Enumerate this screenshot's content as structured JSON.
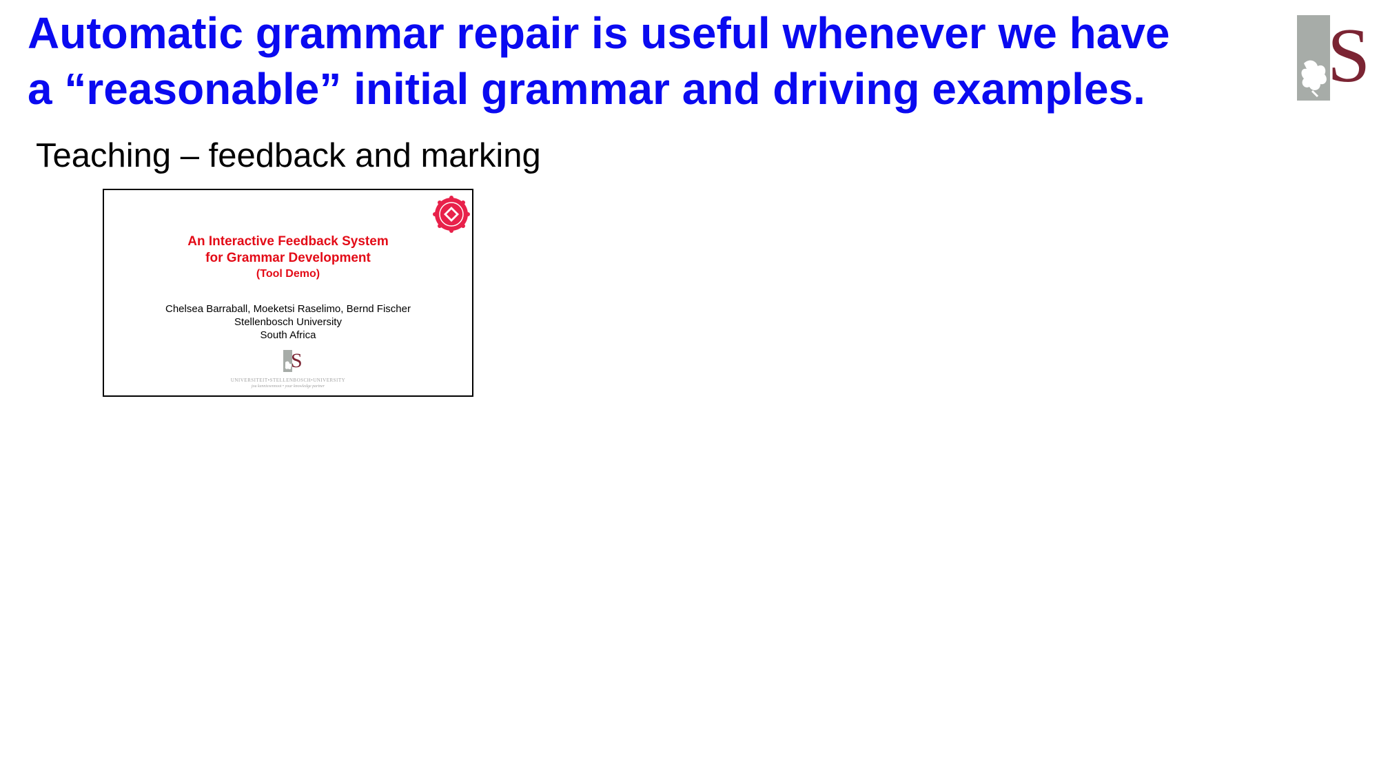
{
  "slide": {
    "title_lines": [
      "Automatic grammar repair is useful whenever we have",
      "a “reasonable” initial grammar and driving examples."
    ],
    "subtitle": "Teaching – feedback and marking"
  },
  "logo": {
    "letter": "S",
    "icon": "stellenbosch-university-logo-icon"
  },
  "thumbnail": {
    "title_line1": "An Interactive Feedback System",
    "title_line2": "for Grammar Development",
    "title_line3": "(Tool Demo)",
    "authors": "Chelsea Barraball, Moeketsi Raselimo, Bernd Fischer",
    "institution": "Stellenbosch University",
    "country": "South Africa",
    "footer_line1": "UNIVERSITEIT•STELLENBOSCH•UNIVERSITY",
    "footer_line2": "jou kennisvennoot • your knowledge partner",
    "seal_icon": "artifact-evaluated-seal-icon"
  },
  "colors": {
    "title": "#0a0af0",
    "thumb_title": "#e30b17",
    "logo_grey": "#a7aca8",
    "logo_maroon": "#7b2433"
  }
}
